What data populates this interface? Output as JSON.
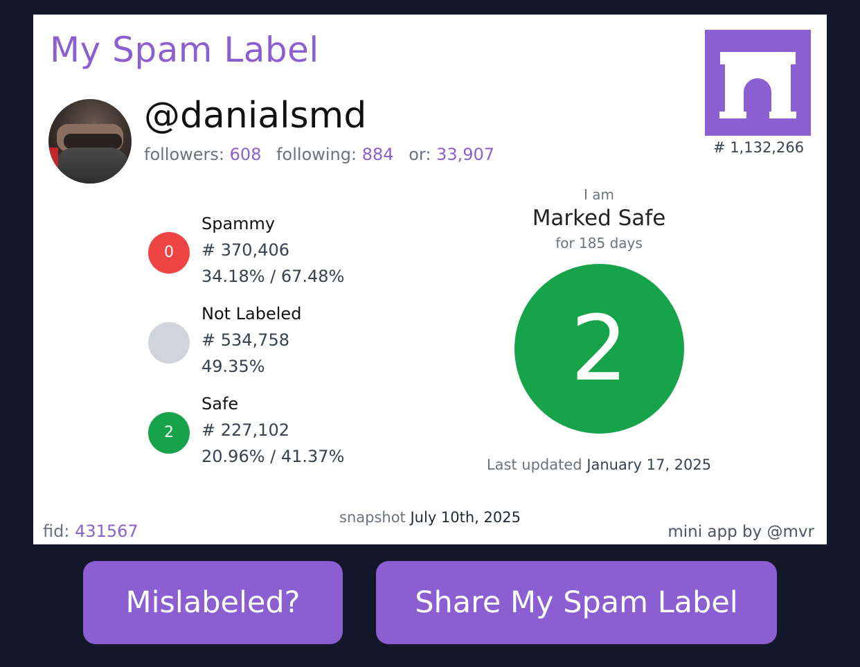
{
  "card": {
    "title": "My Spam Label",
    "handle": "@danialsmd",
    "followers_label": "followers:",
    "followers": "608",
    "following_label": "following:",
    "following": "884",
    "or_label": "or:",
    "or": "33,907",
    "rank": "# 1,132,266",
    "logo_icon": "arch-logo-icon"
  },
  "labels": [
    {
      "circle": "0",
      "color": "#ef4444",
      "name": "Spammy",
      "count": "# 370,406",
      "pct": "34.18% / 67.48%"
    },
    {
      "circle": "",
      "color": "#d1d5db",
      "name": "Not Labeled",
      "count": "# 534,758",
      "pct": "49.35%"
    },
    {
      "circle": "2",
      "color": "#16a34a",
      "name": "Safe",
      "count": "# 227,102",
      "pct": "20.96% / 41.37%"
    }
  ],
  "status": {
    "prefix": "I am",
    "title": "Marked Safe",
    "duration": "for 185 days",
    "value": "2",
    "updated_label": "Last updated",
    "updated_date": "January 17, 2025"
  },
  "footer": {
    "snapshot_label": "snapshot",
    "snapshot_date": "July 10th, 2025",
    "fid_label": "fid:",
    "fid": "431567",
    "credit": "mini app by @mvr"
  },
  "buttons": {
    "mislabeled": "Mislabeled?",
    "share": "Share My Spam Label"
  },
  "colors": {
    "accent": "#8b5fd1",
    "background": "#14172a",
    "safe": "#16a34a",
    "spammy": "#ef4444",
    "unlabeled": "#d1d5db"
  }
}
